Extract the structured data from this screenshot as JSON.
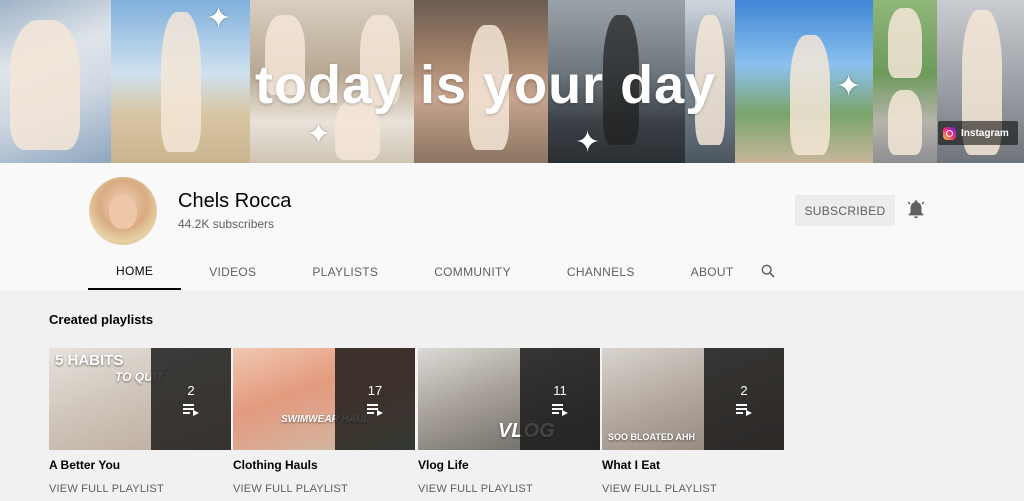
{
  "banner": {
    "text": "today is your day",
    "instagram_label": "Instagram",
    "stars": [
      "✦",
      "✦",
      "✦",
      "✦"
    ]
  },
  "channel": {
    "name": "Chels Rocca",
    "subscribers": "44.2K subscribers",
    "subscribe_label": "SUBSCRIBED"
  },
  "tabs": [
    {
      "label": "HOME",
      "active": true
    },
    {
      "label": "VIDEOS",
      "active": false
    },
    {
      "label": "PLAYLISTS",
      "active": false
    },
    {
      "label": "COMMUNITY",
      "active": false
    },
    {
      "label": "CHANNELS",
      "active": false
    },
    {
      "label": "ABOUT",
      "active": false
    }
  ],
  "section": {
    "title": "Created playlists"
  },
  "playlists": [
    {
      "title": "A Better You",
      "count": "2",
      "link": "VIEW FULL PLAYLIST",
      "thumb_text": "5 HABITS",
      "thumb_text2": "TO QUIT"
    },
    {
      "title": "Clothing Hauls",
      "count": "17",
      "link": "VIEW FULL PLAYLIST",
      "thumb_text": "SWIMWEAR HAUL"
    },
    {
      "title": "Vlog Life",
      "count": "11",
      "link": "VIEW FULL PLAYLIST",
      "thumb_text": "VLOG"
    },
    {
      "title": "What I Eat",
      "count": "2",
      "link": "VIEW FULL PLAYLIST",
      "thumb_text": "SOO BLOATED AHH"
    }
  ],
  "colors": {
    "page_bg": "#f1f1f1",
    "header_bg": "#f9f9f9",
    "text_primary": "#030303",
    "text_secondary": "#606060",
    "button_bg": "#ececec"
  },
  "icons": {
    "bell": "notification-bell-icon",
    "search": "search-icon",
    "playlist": "playlist-icon",
    "instagram": "instagram-icon"
  }
}
